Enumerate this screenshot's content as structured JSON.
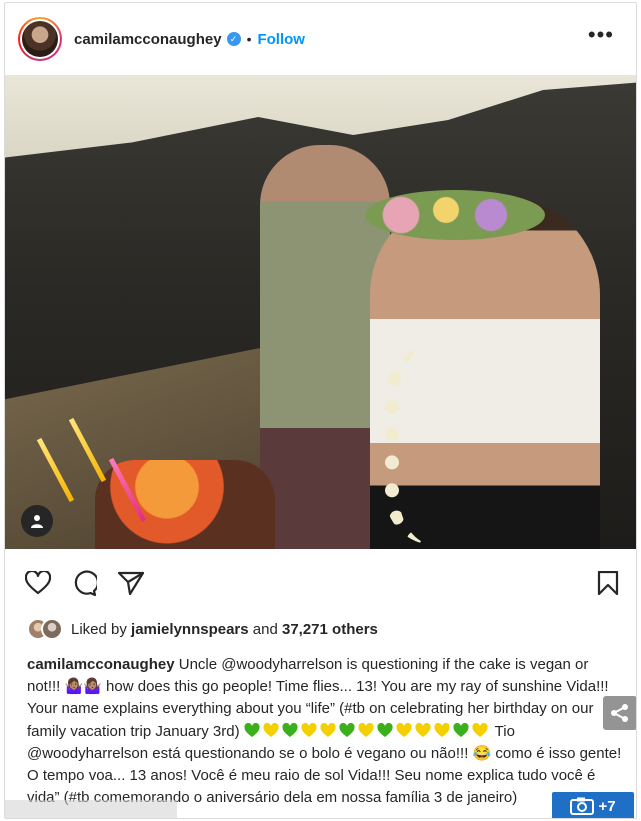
{
  "header": {
    "username": "camilamcconaughey",
    "separator": "•",
    "follow_label": "Follow",
    "more_label": "•••"
  },
  "photo": {
    "tagged_icon": "user-icon"
  },
  "actions": {
    "like_icon": "heart-icon",
    "comment_icon": "comment-icon",
    "share_icon": "send-icon",
    "save_icon": "bookmark-icon"
  },
  "likes": {
    "prefix": "Liked by",
    "user": "jamielynnspears",
    "middle": "and",
    "count": "37,271 others"
  },
  "caption": {
    "username": "camilamcconaughey",
    "text_en": "Uncle @woodyharrelson is questioning if the cake is vegan or not!!! 🤷🏽‍♀️🤷🏽‍♀️ how does this go people! Time flies... 13! You are my ray of sunshine Vida!!! Your name explains everything about you “life” (#tb on celebrating her birthday on our family vacation trip January 3rd)",
    "text_pt_1": "Tio @woodyharrelson está questionando se o bolo é vegano ou não!!! 😂",
    "text_pt_2": "como é isso gente! O tempo voa... 13 anos! Você é meu raio de sol Vida!!! Seu nome explica tudo você é vida” (#tb comemorando o aniversário dela em nossa família 3 de janeiro)",
    "heart_colors": [
      "#3cb01c",
      "#f5d000",
      "#3cb01c",
      "#f5d000",
      "#f5d000",
      "#3cb01c",
      "#f5d000",
      "#3cb01c",
      "#f5d000",
      "#f5d000",
      "#f5d000",
      "#3cb01c",
      "#f5d000"
    ]
  },
  "overlay": {
    "share_icon": "share-icon",
    "gallery_icon": "camera-icon",
    "gallery_count": "+7"
  },
  "colors": {
    "follow": "#0095f6",
    "verified": "#3897f0",
    "gallery_button": "#1f6fc7"
  }
}
